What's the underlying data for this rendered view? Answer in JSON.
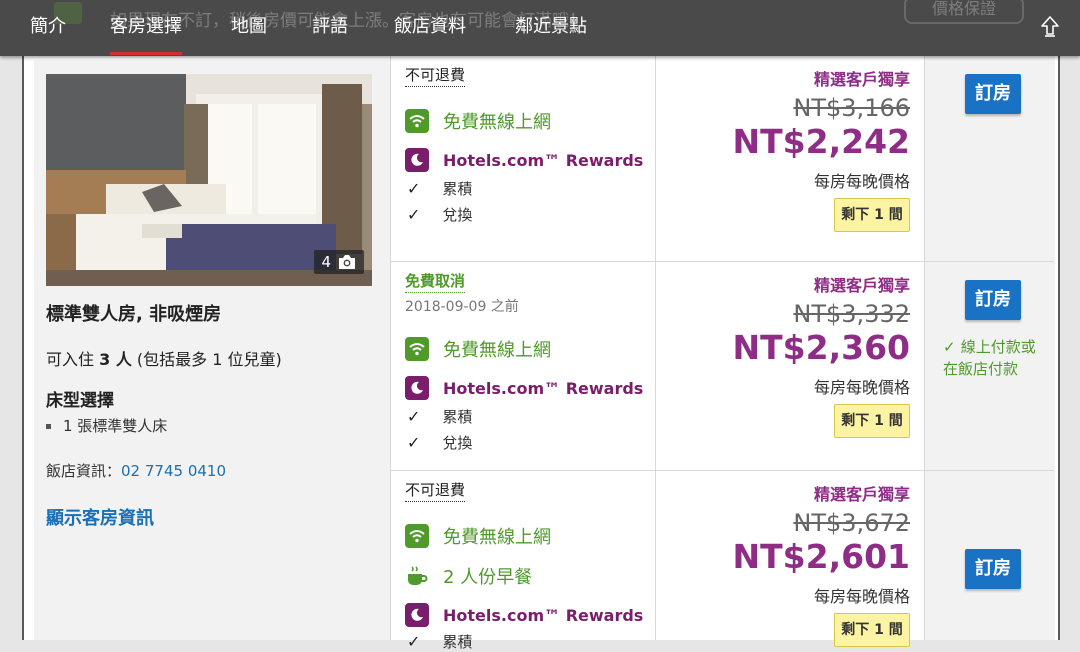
{
  "ghost": {
    "text": "如果現在不訂，稍後房價可能會上漲。客房也有可能會訂滿哦！",
    "badge": "價格保證"
  },
  "nav": {
    "tabs": [
      "簡介",
      "客房選擇",
      "地圖",
      "評語",
      "飯店資料",
      "鄰近景點"
    ],
    "active": "客房選擇"
  },
  "room": {
    "photo_count": "4",
    "name": "標準雙人房, 非吸煙房",
    "occupancy_prefix": "可入住",
    "occupancy_count": "3 人",
    "occupancy_suffix": "(包括最多 1 位兒童)",
    "bed_title": "床型選擇",
    "bed_item": "1 張標準雙人床",
    "hotel_info_label": "飯店資訊：",
    "hotel_phone": "02 7745 0410",
    "show_room_info": "顯示客房資訊"
  },
  "rates": [
    {
      "policy": "不可退費",
      "deadline": "",
      "wifi": "免費無線上網",
      "breakfast": "",
      "rewards": "Hotels.com™ Rewards",
      "earn": "累積",
      "redeem": "兌換",
      "exclusive": "精選客戶獨享",
      "old_price": "NT$3,166",
      "new_price": "NT$2,242",
      "per_night": "每房每晚價格",
      "rooms_left": "剩下 1 間",
      "book": "訂房",
      "pay_note": ""
    },
    {
      "policy": "免費取消",
      "deadline": "2018-09-09 之前",
      "wifi": "免費無線上網",
      "breakfast": "",
      "rewards": "Hotels.com™ Rewards",
      "earn": "累積",
      "redeem": "兌換",
      "exclusive": "精選客戶獨享",
      "old_price": "NT$3,332",
      "new_price": "NT$2,360",
      "per_night": "每房每晚價格",
      "rooms_left": "剩下 1 間",
      "book": "訂房",
      "pay_note": "線上付款或在飯店付款"
    },
    {
      "policy": "不可退費",
      "deadline": "",
      "wifi": "免費無線上網",
      "breakfast": "2 人份早餐",
      "rewards": "Hotels.com™ Rewards",
      "earn": "累積",
      "redeem": "",
      "exclusive": "精選客戶獨享",
      "old_price": "NT$3,672",
      "new_price": "NT$2,601",
      "per_night": "每房每晚價格",
      "rooms_left": "剩下 1 間",
      "book": "訂房",
      "pay_note": ""
    }
  ],
  "icons": [
    "wifi-icon",
    "rewards-icon",
    "check-icon",
    "coffee-icon",
    "camera-icon",
    "scroll-top-icon"
  ],
  "colors": {
    "green": "#4f9a2b",
    "purple": "#8f2d86",
    "blue": "#1a72c4",
    "nav": "#4a4a4a"
  }
}
